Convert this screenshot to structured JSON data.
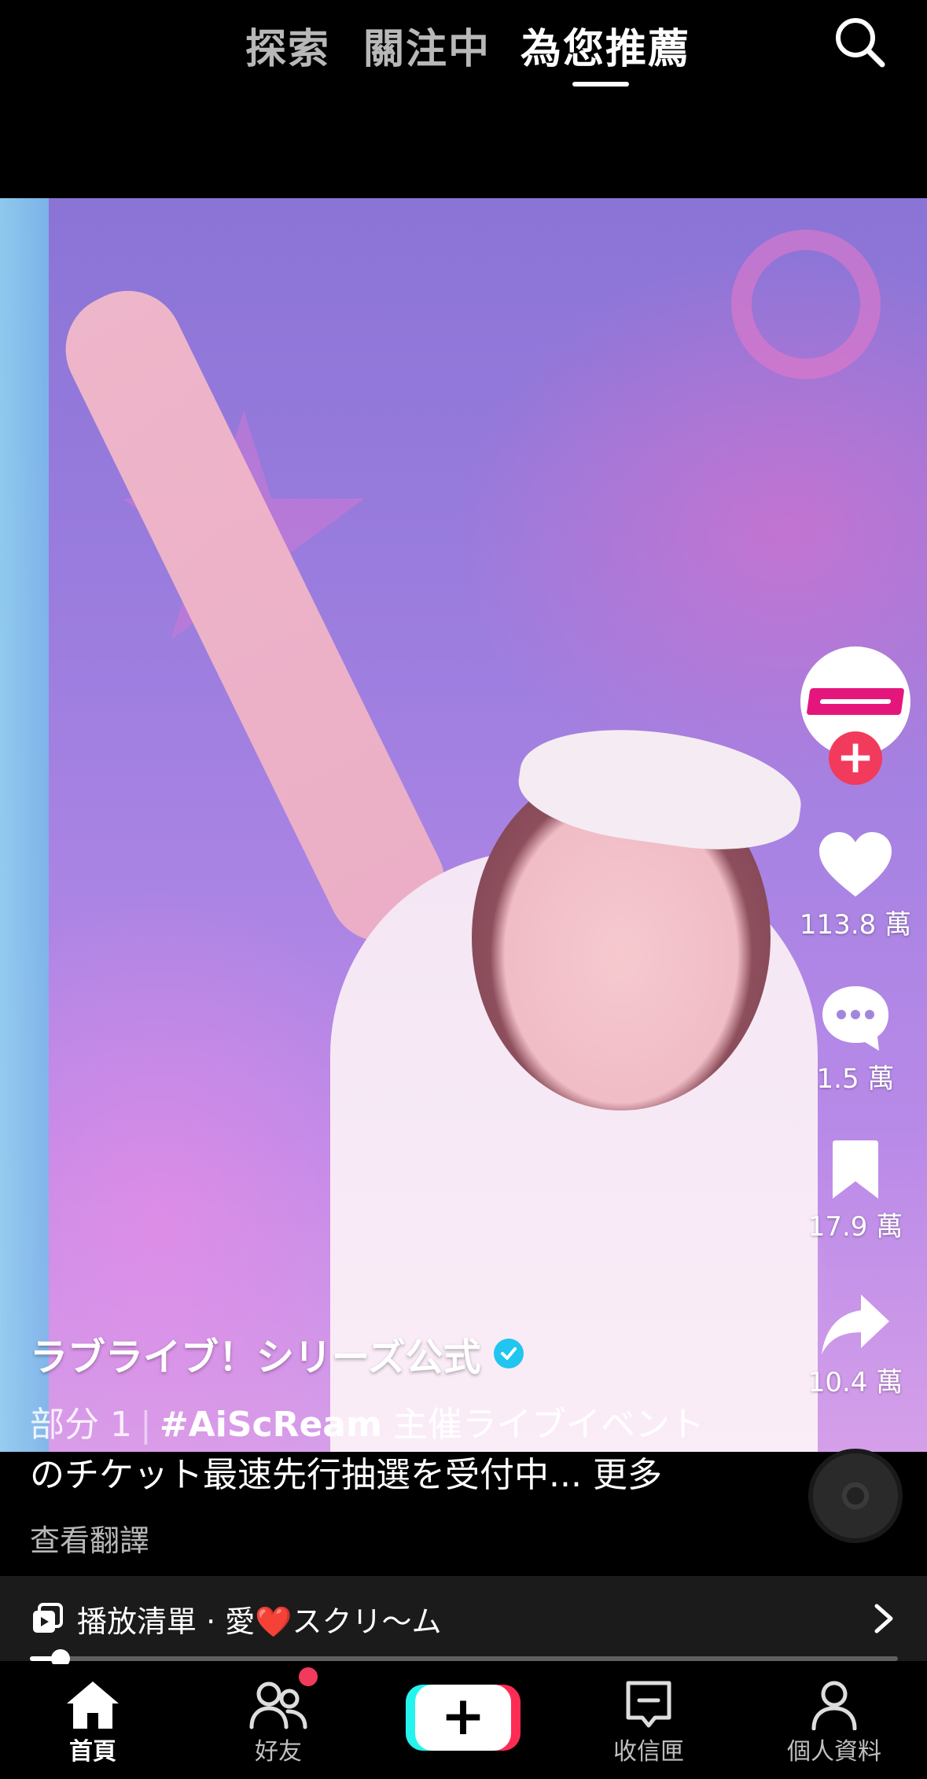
{
  "top_tabs": [
    {
      "label": "探索",
      "active": false
    },
    {
      "label": "關注中",
      "active": false
    },
    {
      "label": "為您推薦",
      "active": true
    }
  ],
  "icons": {
    "search": "search-icon",
    "like": "heart-icon",
    "comment": "comment-icon",
    "save": "bookmark-icon",
    "share": "share-icon"
  },
  "rail": {
    "likes": "113.8 萬",
    "comments": "1.5 萬",
    "saves": "17.9 萬",
    "shares": "10.4 萬",
    "follow_symbol": "+",
    "avatar_brand_color": "#e4167c"
  },
  "caption": {
    "author": "ラブライブ！シリーズ公式",
    "part": "部分 1",
    "separator": "|",
    "hashtag": "#AiScReam",
    "text_line1": " 主催ライブイベント",
    "text_line2": "のチケット最速先行抽選を受付中... ",
    "more": "更多",
    "translate": "查看翻譯"
  },
  "playlist": {
    "label": "播放清單 · 愛❤️スクリ～ム"
  },
  "progress": {
    "fraction": 0.035
  },
  "bottom_nav": {
    "home": "首頁",
    "friends": "好友",
    "create": "+",
    "inbox": "收信匣",
    "profile": "個人資料"
  },
  "colors": {
    "accent_red": "#fe2c55",
    "accent_cyan": "#25f4ee",
    "verified_blue": "#20c5f0"
  }
}
